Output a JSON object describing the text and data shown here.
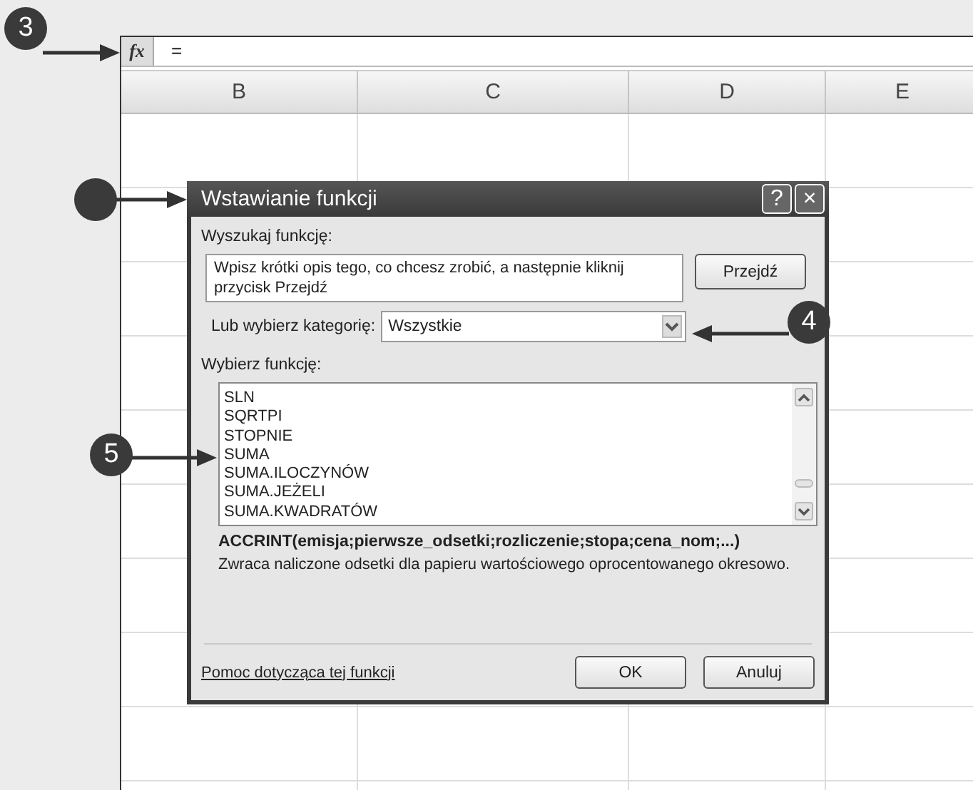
{
  "formula_bar": {
    "fx": "fx",
    "value": "="
  },
  "columns": [
    "B",
    "C",
    "D",
    "E"
  ],
  "dialog": {
    "title": "Wstawianie funkcji",
    "help": "?",
    "close": "×",
    "search_label": "Wyszukaj funkcję:",
    "search_value": "Wpisz krótki opis tego, co chcesz zrobić, a następnie kliknij przycisk Przejdź",
    "go_button": "Przejdź",
    "category_label": "Lub wybierz kategorię:",
    "category_value": "Wszystkie",
    "list_label": "Wybierz funkcję:",
    "functions": [
      {
        "name": "SLN",
        "selected": false
      },
      {
        "name": "SQRTPI",
        "selected": false
      },
      {
        "name": "STOPNIE",
        "selected": false
      },
      {
        "name": "SUMA",
        "selected": false
      },
      {
        "name": "SUMA.ILOCZYNÓW",
        "selected": false
      },
      {
        "name": "SUMA.JEŻELI",
        "selected": false
      },
      {
        "name": "SUMA.KWADRATÓW",
        "selected": false
      }
    ],
    "signature": "ACCRINT(emisja;pierwsze_odsetki;rozliczenie;stopa;cena_nom;...)",
    "description": "Zwraca naliczone odsetki dla papieru wartościowego oprocentowanego okresowo.",
    "help_link": "Pomoc dotycząca tej funkcji",
    "buttons": [
      "OK",
      "Anuluj"
    ]
  },
  "callouts": [
    {
      "kind": "numbered",
      "number": "3"
    },
    {
      "kind": "plain"
    },
    {
      "kind": "numbered",
      "number": "4"
    },
    {
      "kind": "numbered",
      "number": "5"
    }
  ]
}
